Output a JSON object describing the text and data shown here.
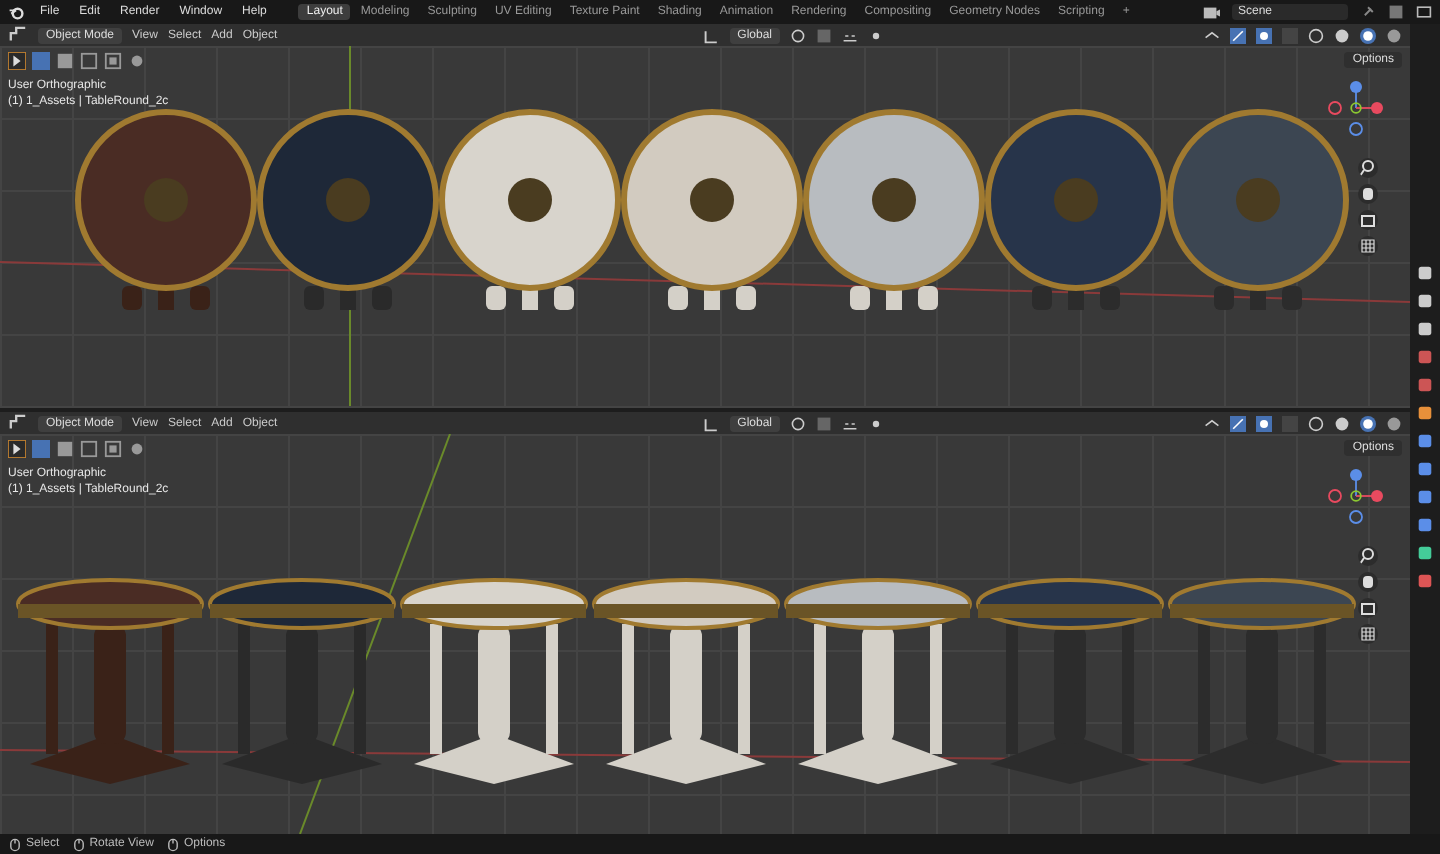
{
  "menu": [
    "File",
    "Edit",
    "Render",
    "Window",
    "Help"
  ],
  "workspace_tabs": [
    {
      "label": "Layout",
      "selected": true
    },
    {
      "label": "Modeling",
      "selected": false
    },
    {
      "label": "Sculpting",
      "selected": false
    },
    {
      "label": "UV Editing",
      "selected": false
    },
    {
      "label": "Texture Paint",
      "selected": false
    },
    {
      "label": "Shading",
      "selected": false
    },
    {
      "label": "Animation",
      "selected": false
    },
    {
      "label": "Rendering",
      "selected": false
    },
    {
      "label": "Compositing",
      "selected": false
    },
    {
      "label": "Geometry Nodes",
      "selected": false
    },
    {
      "label": "Scripting",
      "selected": false
    }
  ],
  "add_tab": "+",
  "scene": {
    "value": "Scene"
  },
  "viewports": [
    {
      "kind": "top",
      "mode": "Object Mode",
      "menus": [
        "View",
        "Select",
        "Add",
        "Object"
      ],
      "orientation": "Global",
      "options": "Options",
      "view_name": "User Orthographic",
      "collection": "(1) 1_Assets | TableRound_2c"
    },
    {
      "kind": "side",
      "mode": "Object Mode",
      "menus": [
        "View",
        "Select",
        "Add",
        "Object"
      ],
      "orientation": "Global",
      "options": "Options",
      "view_name": "User Orthographic",
      "collection": "(1) 1_Assets | TableRound_2c"
    }
  ],
  "status_bar": [
    "Select",
    "Rotate View",
    "Options"
  ]
}
